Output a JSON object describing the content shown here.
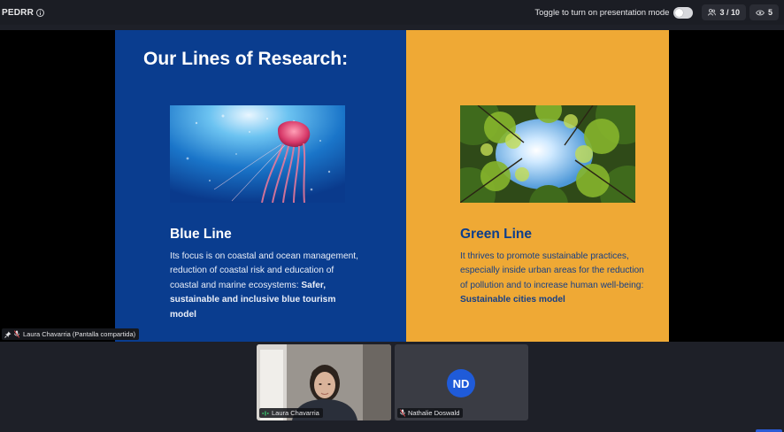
{
  "topbar": {
    "room_name": "PEDRR",
    "toggle_label": "Toggle to turn on presentation mode",
    "participants_count": "3 / 10",
    "viewers_count": "5"
  },
  "slide": {
    "title": "Our Lines of Research:",
    "blue": {
      "heading": "Blue Line",
      "body": "Its focus is on coastal and ocean management, reduction of coastal risk and education of coastal and marine ecosystems: ",
      "body_bold": "Safer, sustainable and inclusive blue tourism model"
    },
    "green": {
      "heading": "Green Line",
      "body": "It thrives to promote sustainable practices, especially inside urban areas for the reduction of pollution and to increase human well-being: ",
      "body_bold": "Sustainable cities  model"
    },
    "colors": {
      "blue_panel": "#0a3d8f",
      "yellow_panel": "#efa935"
    }
  },
  "presenter_tag": "Laura Chavarria (Pantalla compartida)",
  "participants": [
    {
      "name": "Laura Chavarria"
    },
    {
      "name": "Nathalie Doswald",
      "initials": "ND",
      "avatar_color": "#1f5bd9"
    }
  ]
}
